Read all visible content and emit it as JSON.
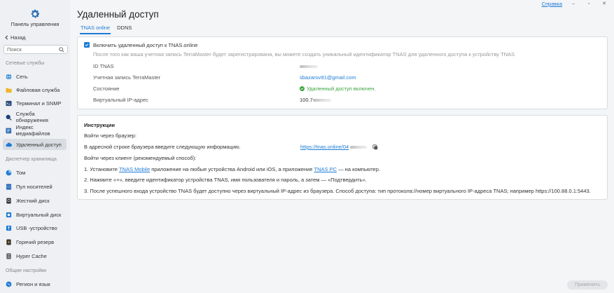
{
  "window": {
    "help_label": "Справка",
    "minimize": "–",
    "maximize": "▫",
    "close": "✕"
  },
  "sidebar": {
    "brand_title": "Панель управления",
    "back_label": "Назад",
    "search_placeholder": "Поиск",
    "groups": [
      {
        "title": "Сетевые службы"
      },
      {
        "title": "Диспетчер хранилища"
      },
      {
        "title": "Общие настройки"
      }
    ],
    "items": [
      {
        "label": "Сеть",
        "icon": "globe-icon",
        "color": "#1e7bd6"
      },
      {
        "label": "Файловая служба",
        "icon": "folder-icon",
        "color": "#f0b429"
      },
      {
        "label": "Терминал и SNMP",
        "icon": "terminal-icon",
        "color": "#2b4c7e"
      },
      {
        "label": "Служба обнаружения",
        "icon": "discovery-icon",
        "color": "#1e3f7a"
      },
      {
        "label": "Индекс медиафайлов",
        "icon": "media-index-icon",
        "color": "#2b6cb0"
      },
      {
        "label": "Удаленный доступ",
        "icon": "cloud-icon",
        "color": "#1e7bd6",
        "active": true
      },
      {
        "label": "Том",
        "icon": "volume-icon",
        "color": "#1e7bd6"
      },
      {
        "label": "Пул носителей",
        "icon": "storage-pool-icon",
        "color": "#1e5fb8"
      },
      {
        "label": "Жесткий диск",
        "icon": "hard-disk-icon",
        "color": "#333333"
      },
      {
        "label": "Виртуальный диск",
        "icon": "virtual-disk-icon",
        "color": "#1e7bd6"
      },
      {
        "label": "USB -устройство",
        "icon": "usb-icon",
        "color": "#1e7bd6"
      },
      {
        "label": "Горячий резерв",
        "icon": "hot-spare-icon",
        "color": "#333333"
      },
      {
        "label": "Hyper Cache",
        "icon": "hyper-cache-icon",
        "color": "#555555"
      },
      {
        "label": "Регион и язык",
        "icon": "region-icon",
        "color": "#1e7bd6"
      }
    ]
  },
  "main": {
    "title": "Удаленный доступ",
    "tabs": [
      {
        "label": "TNAS online",
        "active": true
      },
      {
        "label": "DDNS",
        "active": false
      }
    ],
    "tnas": {
      "enable_label": "Включить удаленный доступ к TNAS.online",
      "description": "После того как ваша учетная запись TerraMaster будет зарегистрирована, вы можете создать уникальный идентификатор TNAS для удаленного доступа к устройству TNAS",
      "fields": [
        {
          "label": "ID TNAS",
          "value": ""
        },
        {
          "label": "Учетная запись TerraMaster",
          "value": "sbazarov91@gmail.com"
        },
        {
          "label": "Состояние",
          "value": "Удаленный доступ включен."
        },
        {
          "label": "Виртуальный IP-адрес",
          "value": "100.7"
        }
      ]
    },
    "instructions": {
      "title": "Инструкции",
      "browser_heading": "Войти через браузер:",
      "browser_text": "В адресной строке браузера введите следующую информацию.",
      "browser_url": "https://tnas.online/04",
      "client_heading": "Войти через клиент (рекомендуемый способ):",
      "step1_a": "1. Установите ",
      "step1_link1": "TNAS Mobile",
      "step1_b": " приложение на любые устройства Android или iOS, а приложение ",
      "step1_link2": "TNAS PC",
      "step1_c": " — на компьютер.",
      "step2": "2. Нажмите «+», введите идентификатор устройства TNAS, имя пользователя и пароль, а затем — «Подтвердить».",
      "step3": "3. После успешного входа устройство TNAS будет доступно через виртуальный IP-адрес из браузера. Способ доступа: тип протокола://номер виртуального IP-адреса TNAS; например https://100.88.0.1:5443."
    },
    "apply_label": "Применить"
  }
}
